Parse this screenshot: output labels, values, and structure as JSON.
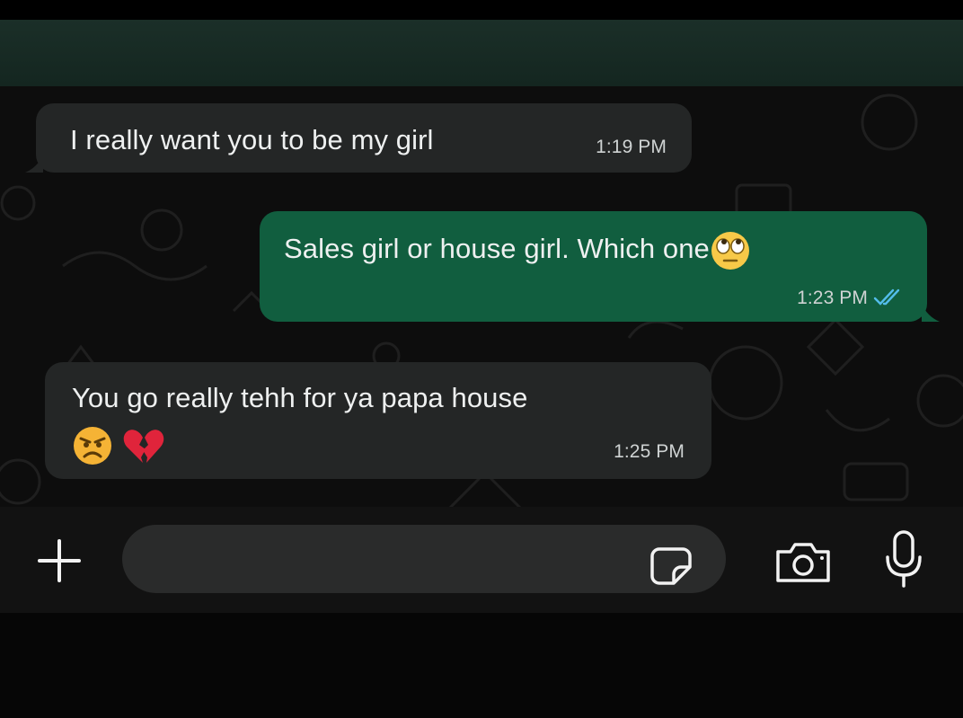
{
  "messages": [
    {
      "direction": "incoming",
      "text": "I really want you to be my girl",
      "time": "1:19 PM"
    },
    {
      "direction": "outgoing",
      "text": "Sales girl or house girl. Which one",
      "emoji": "rolling-eyes-emoji",
      "time": "1:23 PM",
      "status": "read",
      "status_color": "#53bdeb"
    },
    {
      "direction": "incoming",
      "text": "You go really tehh for ya papa house",
      "emojis": [
        "angry-face-emoji",
        "broken-heart-emoji"
      ],
      "time": "1:25 PM"
    }
  ],
  "composer": {
    "placeholder": "",
    "icons": [
      "plus-icon",
      "sticker-icon",
      "camera-icon",
      "mic-icon"
    ]
  },
  "colors": {
    "header": "#1b2f28",
    "chat_background": "#0d0d0d",
    "incoming_bubble": "#242626",
    "outgoing_bubble": "#115e3f",
    "input_field": "#2a2b2b"
  }
}
